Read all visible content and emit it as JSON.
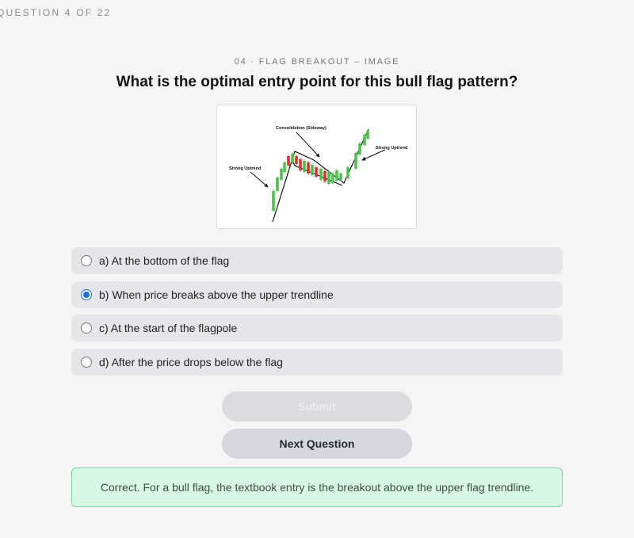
{
  "header": {
    "progress": "QUESTION 4 OF 22"
  },
  "question": {
    "subtitle": "04 · FLAG BREAKOUT – IMAGE",
    "text": "What is the optimal entry point for this bull flag pattern?"
  },
  "figure": {
    "labels": {
      "consolidation": "Consolidation (Sideway)",
      "uptrend_left": "Strong Uptrend",
      "uptrend_right": "Strong Uptrend"
    },
    "colors": {
      "bull": "#4ec24e",
      "bear": "#e03030"
    }
  },
  "options": [
    {
      "label": "a) At the bottom of the flag",
      "selected": false
    },
    {
      "label": "b) When price breaks above the upper trendline",
      "selected": true
    },
    {
      "label": "c) At the start of the flagpole",
      "selected": false
    },
    {
      "label": "d) After the price drops below the flag",
      "selected": false
    }
  ],
  "buttons": {
    "submit": "Submit",
    "next": "Next Question"
  },
  "feedback": {
    "text": "Correct. For a bull flag, the textbook entry is the breakout above the upper flag trendline.",
    "status": "correct",
    "color": "#d7f8e2"
  }
}
